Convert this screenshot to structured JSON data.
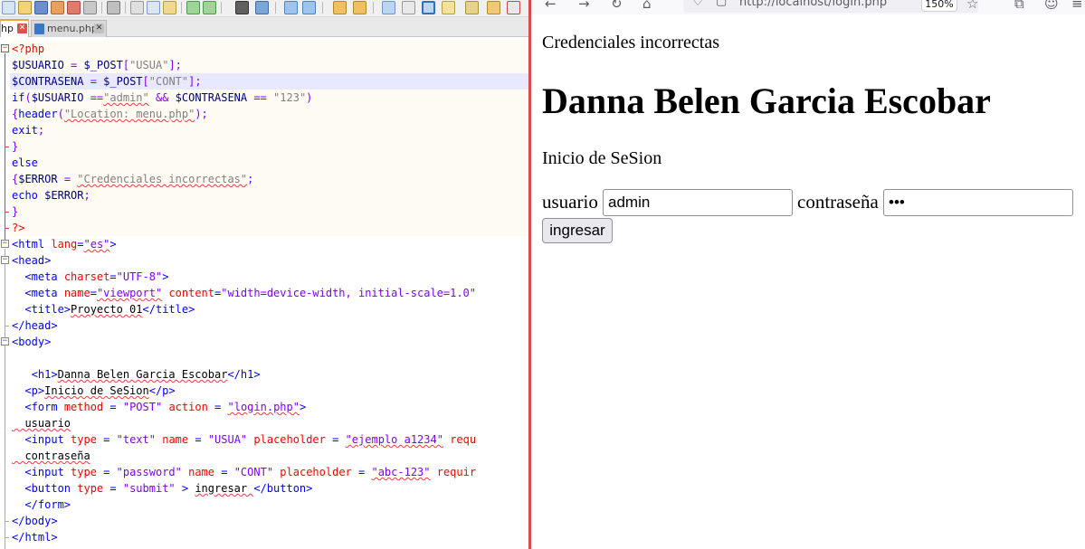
{
  "editor": {
    "tabs": [
      {
        "label": "hp",
        "close_glyph": "✕"
      },
      {
        "label": "menu.php",
        "close_glyph": "✕"
      }
    ],
    "code_lines": [
      {
        "segs": [
          [
            "c-php",
            "<?php"
          ]
        ]
      },
      {
        "segs": [
          [
            "c-var",
            "$USUARIO"
          ],
          [
            "c-op",
            " = "
          ],
          [
            "c-var",
            "$_POST"
          ],
          [
            "c-op",
            "["
          ],
          [
            "c-str",
            "\"USUA\""
          ],
          [
            "c-op",
            "];"
          ]
        ]
      },
      {
        "segs": [
          [
            "c-var",
            "$CONTRASENA"
          ],
          [
            "c-op",
            " = "
          ],
          [
            "c-var",
            "$_POST"
          ],
          [
            "c-op",
            "["
          ],
          [
            "c-str",
            "\"CONT\""
          ],
          [
            "c-op",
            "];"
          ]
        ]
      },
      {
        "segs": [
          [
            "c-kw",
            "if"
          ],
          [
            "c-op",
            "("
          ],
          [
            "c-var",
            "$USUARIO"
          ],
          [
            "c-op",
            " =="
          ],
          [
            "c-str",
            "\"admin\""
          ],
          [
            "c-op",
            " && "
          ],
          [
            "c-var",
            "$CONTRASENA"
          ],
          [
            "c-op",
            " == "
          ],
          [
            "c-str",
            "\"123\""
          ],
          [
            "c-op",
            ")"
          ]
        ]
      },
      {
        "segs": [
          [
            "c-op",
            "{"
          ],
          [
            "c-kw",
            "header"
          ],
          [
            "c-op",
            "("
          ],
          [
            "c-str",
            "\"Location: menu.php\""
          ],
          [
            "c-op",
            ");"
          ]
        ]
      },
      {
        "segs": [
          [
            "c-kw",
            "exit"
          ],
          [
            "c-op",
            ";"
          ]
        ]
      },
      {
        "segs": [
          [
            "c-op",
            "}"
          ]
        ]
      },
      {
        "segs": [
          [
            "c-kw",
            "else"
          ]
        ]
      },
      {
        "segs": [
          [
            "c-op",
            "{"
          ],
          [
            "c-var",
            "$ERROR"
          ],
          [
            "c-op",
            " = "
          ],
          [
            "c-str",
            "\"Credenciales incorrectas\""
          ],
          [
            "c-op",
            ";"
          ]
        ]
      },
      {
        "segs": [
          [
            "c-kw",
            "echo"
          ],
          [
            "c-var",
            " $ERROR"
          ],
          [
            "c-op",
            ";"
          ]
        ]
      },
      {
        "segs": [
          [
            "c-op",
            "}"
          ]
        ]
      },
      {
        "segs": [
          [
            "c-php",
            "?>"
          ]
        ]
      },
      {
        "segs": [
          [
            "c-tag",
            "<html "
          ],
          [
            "c-attr",
            "lang"
          ],
          [
            "c-tag",
            "="
          ],
          [
            "c-val",
            "\"es\""
          ],
          [
            "c-tag",
            ">"
          ]
        ]
      },
      {
        "segs": [
          [
            "c-tag",
            "<head>"
          ]
        ]
      },
      {
        "segs": [
          [
            "c-txt",
            "  "
          ],
          [
            "c-tag",
            "<meta "
          ],
          [
            "c-attr",
            "charset"
          ],
          [
            "c-tag",
            "="
          ],
          [
            "c-val",
            "\"UTF-8\""
          ],
          [
            "c-tag",
            ">"
          ]
        ]
      },
      {
        "segs": [
          [
            "c-txt",
            "  "
          ],
          [
            "c-tag",
            "<meta "
          ],
          [
            "c-attr",
            "name"
          ],
          [
            "c-tag",
            "="
          ],
          [
            "c-val",
            "\"viewport\""
          ],
          [
            "c-txt",
            " "
          ],
          [
            "c-attr",
            "content"
          ],
          [
            "c-tag",
            "="
          ],
          [
            "c-val",
            "\"width=device-width, initial-scale=1.0\""
          ]
        ]
      },
      {
        "segs": [
          [
            "c-txt",
            "  "
          ],
          [
            "c-tag",
            "<title>"
          ],
          [
            "c-txt",
            "Proyecto 01"
          ],
          [
            "c-tag",
            "</title>"
          ]
        ]
      },
      {
        "segs": [
          [
            "c-tag",
            "</head>"
          ]
        ]
      },
      {
        "segs": [
          [
            "c-tag",
            "<body>"
          ]
        ]
      },
      {
        "segs": [
          [
            "c-txt",
            ""
          ]
        ]
      },
      {
        "segs": [
          [
            "c-txt",
            "   "
          ],
          [
            "c-tag",
            "<h1>"
          ],
          [
            "c-txt",
            "Danna Belen Garcia Escobar"
          ],
          [
            "c-tag",
            "</h1>"
          ]
        ]
      },
      {
        "segs": [
          [
            "c-txt",
            "  "
          ],
          [
            "c-tag",
            "<p>"
          ],
          [
            "c-txt",
            "Inicio de SeSion"
          ],
          [
            "c-tag",
            "</p>"
          ]
        ]
      },
      {
        "segs": [
          [
            "c-txt",
            "  "
          ],
          [
            "c-tag",
            "<form "
          ],
          [
            "c-attr",
            "method"
          ],
          [
            "c-tag",
            " = "
          ],
          [
            "c-val",
            "\"POST\""
          ],
          [
            "c-txt",
            " "
          ],
          [
            "c-attr",
            "action"
          ],
          [
            "c-tag",
            " = "
          ],
          [
            "c-val",
            "\"login.php\""
          ],
          [
            "c-tag",
            ">"
          ]
        ]
      },
      {
        "segs": [
          [
            "c-txt",
            "  usuario"
          ]
        ]
      },
      {
        "segs": [
          [
            "c-txt",
            "  "
          ],
          [
            "c-tag",
            "<input "
          ],
          [
            "c-attr",
            "type"
          ],
          [
            "c-tag",
            " = "
          ],
          [
            "c-val",
            "\"text\""
          ],
          [
            "c-txt",
            " "
          ],
          [
            "c-attr",
            "name"
          ],
          [
            "c-tag",
            " = "
          ],
          [
            "c-val",
            "\"USUA\""
          ],
          [
            "c-txt",
            " "
          ],
          [
            "c-attr",
            "placeholder"
          ],
          [
            "c-tag",
            " = "
          ],
          [
            "c-val",
            "\"ejemplo a1234\""
          ],
          [
            "c-txt",
            " "
          ],
          [
            "c-attr",
            "requ"
          ]
        ]
      },
      {
        "segs": [
          [
            "c-txt",
            "  contraseña"
          ]
        ]
      },
      {
        "segs": [
          [
            "c-txt",
            "  "
          ],
          [
            "c-tag",
            "<input "
          ],
          [
            "c-attr",
            "type"
          ],
          [
            "c-tag",
            " = "
          ],
          [
            "c-val",
            "\"password\""
          ],
          [
            "c-txt",
            " "
          ],
          [
            "c-attr",
            "name"
          ],
          [
            "c-tag",
            " = "
          ],
          [
            "c-val",
            "\"CONT\""
          ],
          [
            "c-txt",
            " "
          ],
          [
            "c-attr",
            "placeholder"
          ],
          [
            "c-tag",
            " = "
          ],
          [
            "c-val",
            "\"abc-123\""
          ],
          [
            "c-txt",
            " "
          ],
          [
            "c-attr",
            "requir"
          ]
        ]
      },
      {
        "segs": [
          [
            "c-txt",
            "  "
          ],
          [
            "c-tag",
            "<button "
          ],
          [
            "c-attr",
            "type"
          ],
          [
            "c-tag",
            " = "
          ],
          [
            "c-val",
            "\"submit\""
          ],
          [
            "c-tag",
            " > "
          ],
          [
            "c-txt",
            "ingresar "
          ],
          [
            "c-tag",
            "</button>"
          ]
        ]
      },
      {
        "segs": [
          [
            "c-txt",
            "  "
          ],
          [
            "c-tag",
            "</form>"
          ]
        ]
      },
      {
        "segs": [
          [
            "c-tag",
            "</body>"
          ]
        ]
      },
      {
        "segs": [
          [
            "c-tag",
            "</html>"
          ]
        ]
      }
    ]
  },
  "browser": {
    "nav": {
      "back": "←",
      "forward": "→",
      "reload": "↻",
      "home": "⌂",
      "star": "☆",
      "extensions": "⧉",
      "account": "☺",
      "menu": "≡"
    },
    "url": "http://localhost/login.php",
    "zoom": "150%",
    "shield_glyph": "♡",
    "page_icon_glyph": "▢",
    "page": {
      "error": "Credenciales incorrectas",
      "title": "Danna Belen Garcia Escobar",
      "subtitle": "Inicio de SeSion",
      "form": {
        "user_label": "usuario",
        "user_value": "admin",
        "pass_label": "contraseña",
        "pass_value": "•••",
        "submit_label": "ingresar"
      }
    }
  }
}
